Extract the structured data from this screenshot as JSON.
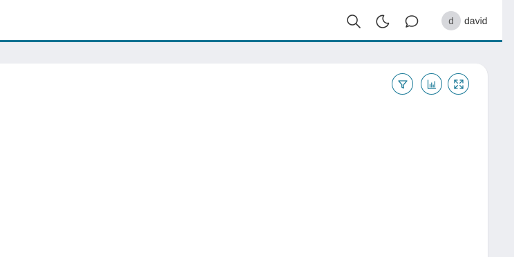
{
  "header": {
    "icons": [
      "search-icon",
      "moon-icon",
      "chat-icon"
    ],
    "user": {
      "avatar_initial": "d",
      "name": "david"
    }
  },
  "panel": {
    "actions": [
      "filter-icon",
      "bar-chart-icon",
      "expand-icon"
    ]
  },
  "colors": {
    "accent": "#0f7191",
    "background": "#edeef2",
    "panel": "#ffffff",
    "avatar_bg": "#d7d8dc"
  }
}
